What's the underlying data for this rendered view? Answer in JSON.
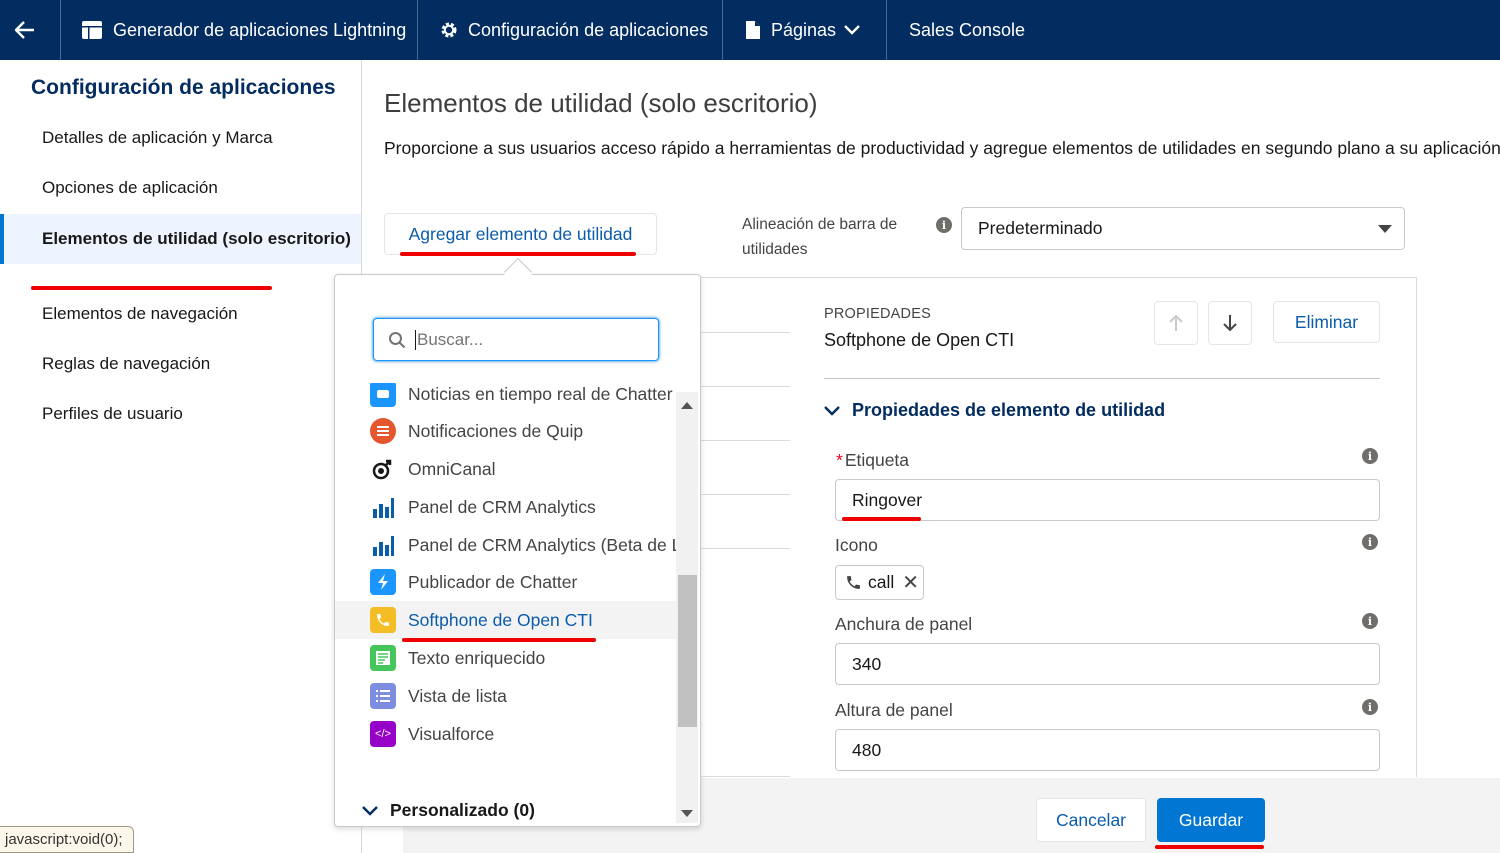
{
  "topbar": {
    "back_icon": "arrow-left-icon",
    "app_builder": "Generador de aplicaciones Lightning",
    "app_settings": "Configuración de aplicaciones",
    "pages": "Páginas",
    "app_name": "Sales Console"
  },
  "sidebar": {
    "title": "Configuración de aplicaciones",
    "items": [
      {
        "label": "Detalles de aplicación y Marca"
      },
      {
        "label": "Opciones de aplicación"
      },
      {
        "label": "Elementos de utilidad (solo escritorio)",
        "active": true
      },
      {
        "label": "Elementos de navegación"
      },
      {
        "label": "Reglas de navegación"
      },
      {
        "label": "Perfiles de usuario"
      }
    ]
  },
  "main": {
    "title": "Elementos de utilidad (solo escritorio)",
    "description": "Proporcione a sus usuarios acceso rápido a herramientas de productividad y agregue elementos de utilidades en segundo plano a su aplicación.",
    "add_button": "Agregar elemento de utilidad",
    "alignment_label": "Alineación de barra de utilidades",
    "alignment_value": "Predeterminado"
  },
  "dropdown": {
    "search_placeholder": "Buscar...",
    "items": [
      {
        "label": "Noticias en tiempo real de Chatter",
        "icon": "chatter-feed-icon",
        "color": "#1b96ff"
      },
      {
        "label": "Notificaciones de Quip",
        "icon": "quip-icon",
        "color": "#e4572e"
      },
      {
        "label": "OmniCanal",
        "icon": "omni-channel-icon",
        "color": "#181818"
      },
      {
        "label": "Panel de CRM Analytics",
        "icon": "dashboard-icon",
        "color": "#0b5cab"
      },
      {
        "label": "Panel de CRM Analytics (Beta de L",
        "icon": "dashboard-icon",
        "color": "#0b5cab"
      },
      {
        "label": "Publicador de Chatter",
        "icon": "chatter-publisher-icon",
        "color": "#1b96ff"
      },
      {
        "label": "Softphone de Open CTI",
        "icon": "call-icon",
        "color": "#f4bc25",
        "selected": true
      },
      {
        "label": "Texto enriquecido",
        "icon": "rich-text-icon",
        "color": "#45c65a"
      },
      {
        "label": "Vista de lista",
        "icon": "list-view-icon",
        "color": "#7f8de1"
      },
      {
        "label": "Visualforce",
        "icon": "visualforce-icon",
        "color": "#9602c7"
      }
    ],
    "group_label": "Personalizado (0)"
  },
  "properties": {
    "eyebrow": "PROPIEDADES",
    "name": "Softphone de Open CTI",
    "delete": "Eliminar",
    "section": "Propiedades de elemento de utilidad",
    "label_field": "Etiqueta",
    "label_required": "*",
    "label_value": "Ringover",
    "icon_field": "Icono",
    "icon_value": "call",
    "width_field": "Anchura de panel",
    "width_value": "340",
    "height_field": "Altura de panel",
    "height_value": "480"
  },
  "footer": {
    "cancel": "Cancelar",
    "save": "Guardar"
  },
  "status_bar": "javascript:void(0);"
}
